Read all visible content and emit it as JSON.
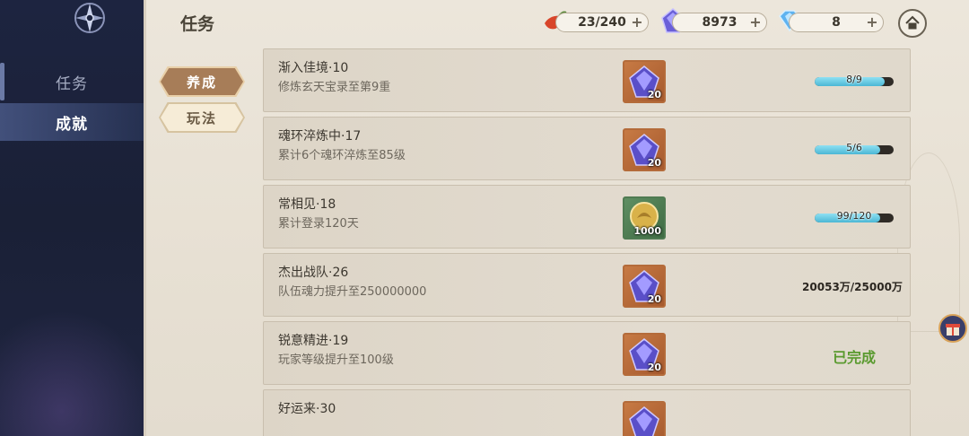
{
  "sidebar": {
    "items": [
      {
        "label": "任务",
        "active": false
      },
      {
        "label": "成就",
        "active": true
      }
    ]
  },
  "header": {
    "title": "任务",
    "currencies": [
      {
        "name": "stamina",
        "value": "23/240",
        "icon": "chili-icon"
      },
      {
        "name": "soul-crystal",
        "value": "8973",
        "icon": "purple-crystal-icon"
      },
      {
        "name": "diamond",
        "value": "8",
        "icon": "blue-diamond-icon"
      }
    ],
    "home_icon": "home-icon"
  },
  "tabs": [
    {
      "label": "养成",
      "selected": true
    },
    {
      "label": "玩法",
      "selected": false
    }
  ],
  "tasks": [
    {
      "title": "渐入佳境·10",
      "desc": "修炼玄天宝录至第9重",
      "reward_icon": "purple-crystal-icon",
      "reward_count": "20",
      "progress_text": "8/9",
      "progress_value": 0.889,
      "status": "in_progress"
    },
    {
      "title": "魂环淬炼中·17",
      "desc": "累计6个魂环淬炼至85级",
      "reward_icon": "purple-crystal-icon",
      "reward_count": "20",
      "progress_text": "5/6",
      "progress_value": 0.833,
      "status": "in_progress"
    },
    {
      "title": "常相见·18",
      "desc": "累计登录120天",
      "reward_icon": "gold-coin-icon",
      "reward_count": "1000",
      "progress_text": "99/120",
      "progress_value": 0.825,
      "status": "in_progress"
    },
    {
      "title": "杰出战队·26",
      "desc": "队伍魂力提升至250000000",
      "reward_icon": "purple-crystal-icon",
      "reward_count": "20",
      "progress_text": "20053万/25000万",
      "status": "in_progress"
    },
    {
      "title": "锐意精进·19",
      "desc": "玩家等级提升至100级",
      "reward_icon": "purple-crystal-icon",
      "reward_count": "20",
      "progress_text": "已完成",
      "status": "done"
    },
    {
      "title": "好运来·30",
      "desc": "",
      "reward_icon": "purple-crystal-icon",
      "reward_count": "",
      "progress_text": "",
      "status": "partial"
    }
  ],
  "colors": {
    "accent_tab": "#a77d58",
    "progress": "#4bb7d4",
    "done": "#5a9a2f",
    "sidebar_bg": "#1d2440",
    "panel_bg": "#ece6db"
  }
}
